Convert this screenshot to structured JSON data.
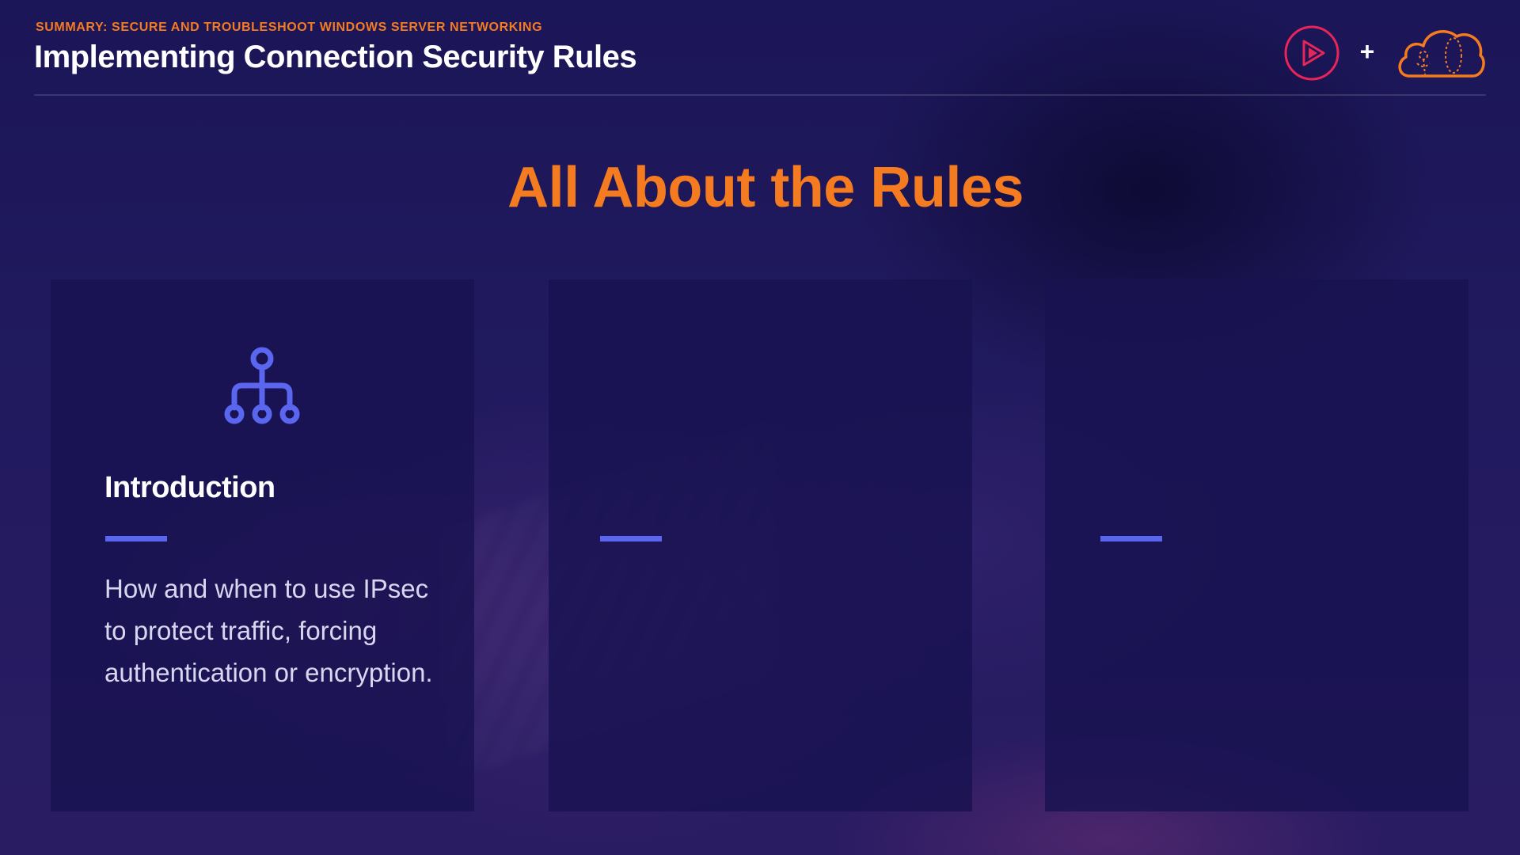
{
  "header": {
    "subtitle": "SUMMARY: SECURE AND TROUBLESHOOT WINDOWS SERVER NETWORKING",
    "title": "Implementing Connection Security Rules",
    "plus": "+"
  },
  "logos": {
    "play_icon": "play-logo-icon",
    "cloud_icon": "cloud-logo-icon"
  },
  "slide": {
    "title": "All About the Rules"
  },
  "cards": [
    {
      "icon": "hierarchy-icon",
      "heading": "Introduction",
      "body": "How and when to use IPsec to protect traffic, forcing authentication or encryption."
    },
    {
      "icon": "",
      "heading": "",
      "body": ""
    },
    {
      "icon": "",
      "heading": "",
      "body": ""
    }
  ],
  "colors": {
    "accent_orange": "#f47b20",
    "accent_blue": "#5a66f0",
    "play_logo": "#e8255a",
    "background": "#1a1454",
    "card": "#181250"
  }
}
